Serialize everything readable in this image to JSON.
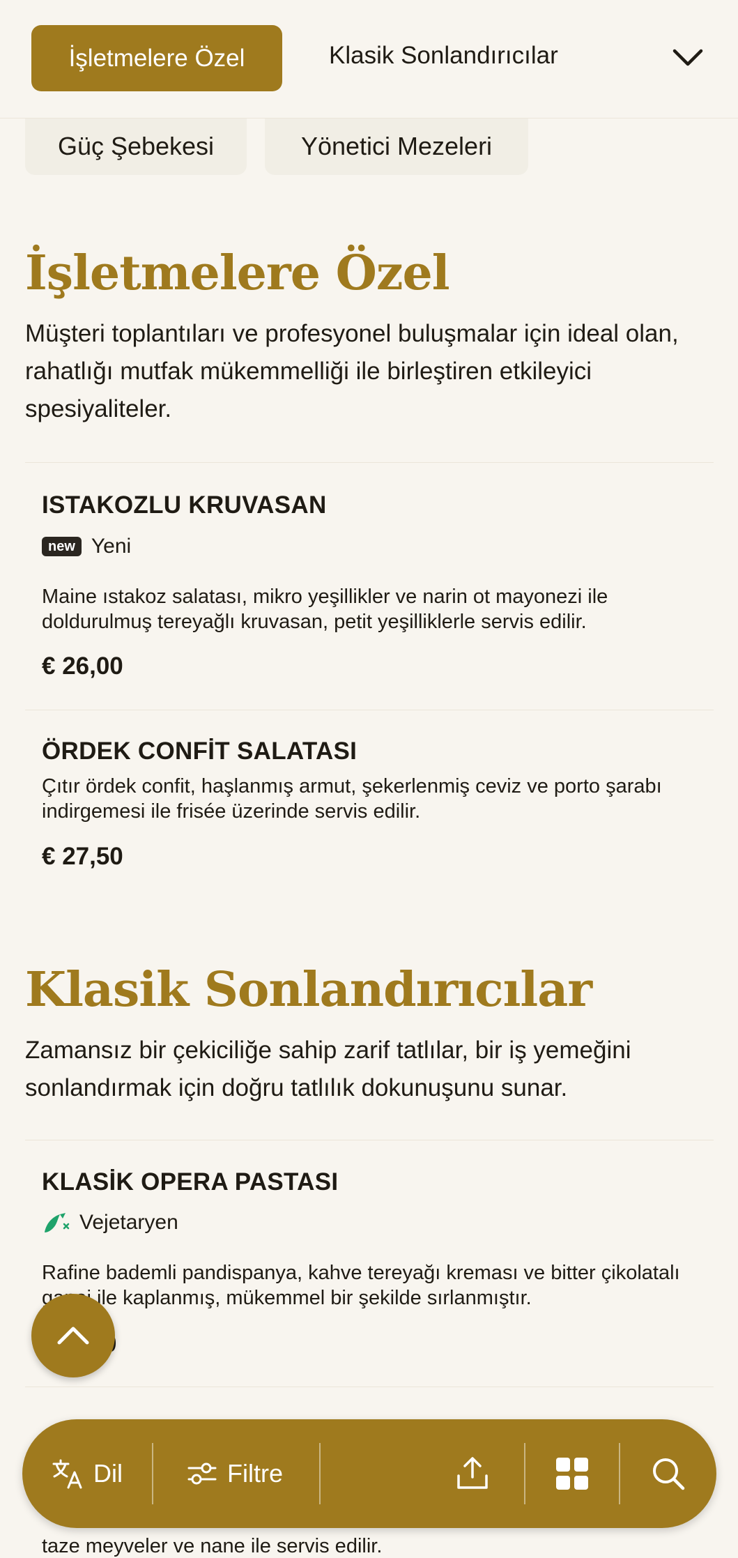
{
  "header": {
    "active_chip": "İşletmelere Özel",
    "next_label": "Klasik Sonlandırıcılar",
    "dropdown_icon": "chevron-down-icon"
  },
  "chips": [
    "Güç Şebekesi",
    "Yönetici Mezeleri"
  ],
  "sections": [
    {
      "title": "İşletmelere Özel",
      "description": "Müşteri toplantıları ve profesyonel buluşmalar için ideal olan, rahatlığı mutfak mükemmelliği ile birleştiren etkileyici spesiyaliteler.",
      "items": [
        {
          "name": "ISTAKOZLU KRUVASAN",
          "badge": "new",
          "tag": "Yeni",
          "description": "Maine ıstakoz salatası, mikro yeşillikler ve narin ot mayonezi ile doldurulmuş tereyağlı kruvasan, petit yeşilliklerle servis edilir.",
          "price": "€ 26,00"
        },
        {
          "name": "ÖRDEK CONFİT SALATASI",
          "description": "Çıtır ördek confit, haşlanmış armut, şekerlenmiş ceviz ve porto şarabı indirgemesi ile frisée üzerinde servis edilir.",
          "price": "€ 27,50"
        }
      ]
    },
    {
      "title": "Klasik Sonlandırıcılar",
      "description": "Zamansız bir çekiciliğe sahip zarif tatlılar, bir iş yemeğini sonlandırmak için doğru tatlılık dokunuşunu sunar.",
      "items": [
        {
          "name": "KLASİK OPERA PASTASI",
          "tag": "Vejetaryen",
          "tag_icon": "vegetarian-leaf-icon",
          "description": "Rafine bademli pandispanya, kahve tereyağı kreması ve bitter çikolatalı ganaj ile kaplanmış, mükemmel bir şekilde sırlanmıştır.",
          "price": "0"
        },
        {
          "description_tail": "taze meyveler ve nane ile servis edilir."
        }
      ]
    }
  ],
  "bottom_bar": {
    "language_label": "Dil",
    "filter_label": "Filtre"
  },
  "colors": {
    "accent": "#9f7a1e",
    "background": "#f8f5ef",
    "vegetarian": "#1fa36b"
  }
}
